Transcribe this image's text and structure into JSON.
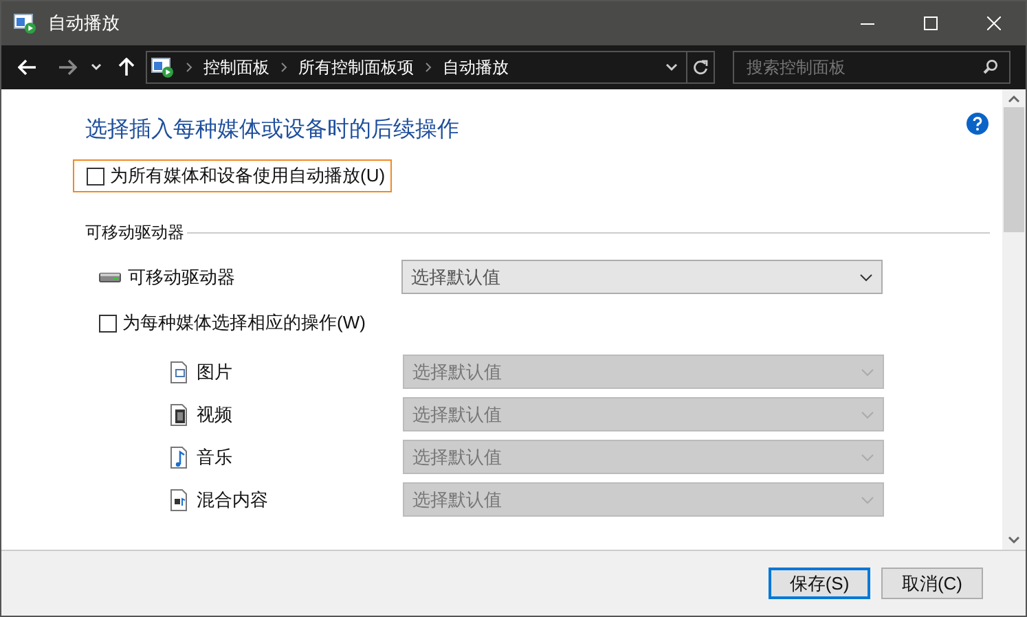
{
  "window": {
    "title": "自动播放"
  },
  "breadcrumb": [
    "控制面板",
    "所有控制面板项",
    "自动播放"
  ],
  "search": {
    "placeholder": "搜索控制面板"
  },
  "heading": "选择插入每种媒体或设备时的后续操作",
  "autoplay_all": {
    "label": "为所有媒体和设备使用自动播放(U)",
    "checked": false,
    "focused": true
  },
  "section": {
    "title": "可移动驱动器"
  },
  "drive": {
    "label": "可移动驱动器",
    "value": "选择默认值",
    "disabled": false
  },
  "per_media": {
    "label": "为每种媒体选择相应的操作(W)",
    "checked": false
  },
  "media": [
    {
      "kind": "picture",
      "label": "图片",
      "value": "选择默认值",
      "disabled": true
    },
    {
      "kind": "video",
      "label": "视频",
      "value": "选择默认值",
      "disabled": true
    },
    {
      "kind": "music",
      "label": "音乐",
      "value": "选择默认值",
      "disabled": true
    },
    {
      "kind": "mixed",
      "label": "混合内容",
      "value": "选择默认值",
      "disabled": true
    }
  ],
  "buttons": [
    {
      "label": "保存(S)",
      "default": true
    },
    {
      "label": "取消(C)",
      "default": false
    }
  ]
}
